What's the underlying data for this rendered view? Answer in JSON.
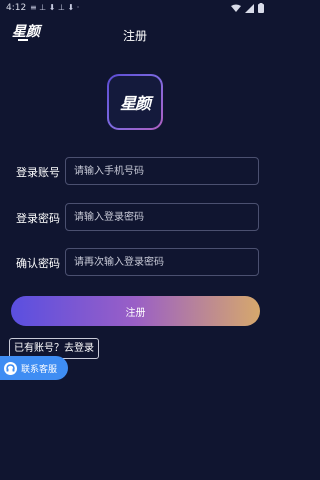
{
  "status_bar": {
    "time": "4:12",
    "notification_glyphs": "≡ ⊥ ⬇ ⊥ ⬇ ·"
  },
  "header": {
    "brand_logo_text": "星颜",
    "title": "注册"
  },
  "logo": {
    "text": "星颜"
  },
  "form": {
    "account": {
      "label": "登录账号",
      "placeholder": "请输入手机号码",
      "value": ""
    },
    "password": {
      "label": "登录密码",
      "placeholder": "请输入登录密码",
      "value": ""
    },
    "confirm": {
      "label": "确认密码",
      "placeholder": "请再次输入登录密码",
      "value": ""
    }
  },
  "register_button": {
    "label": "注册"
  },
  "login_link": {
    "label": "已有账号？去登录"
  },
  "support": {
    "label": "联系客服"
  },
  "colors": {
    "background": "#101530",
    "accent_start": "#5a4fe0",
    "accent_end": "#d6a86c",
    "support_blue": "#3f8df3"
  }
}
